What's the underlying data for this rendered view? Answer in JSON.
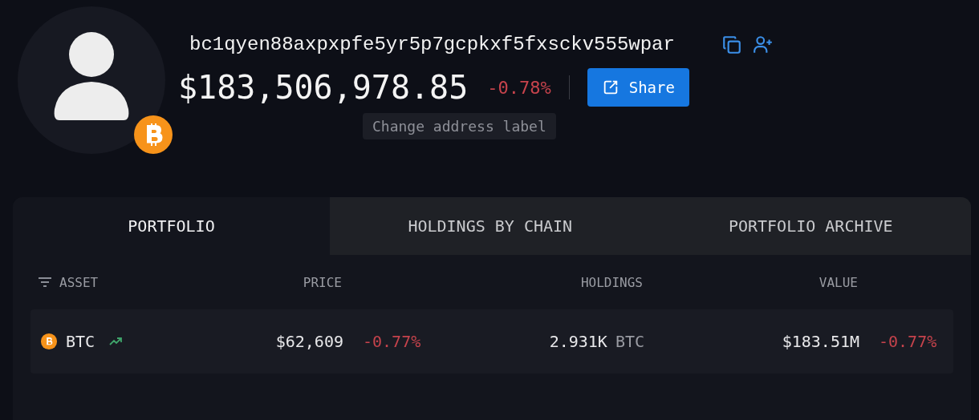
{
  "profile": {
    "address": "bc1qyen88axpxpfe5yr5p7gcpkxf5fxsckv555wpar",
    "balance": "$183,506,978.85",
    "change": "-0.78%",
    "tooltip": "Change address label",
    "share_button": "Share"
  },
  "tabs": [
    {
      "label": "PORTFOLIO",
      "selected": true
    },
    {
      "label": "HOLDINGS BY CHAIN",
      "selected": false
    },
    {
      "label": "PORTFOLIO ARCHIVE",
      "selected": false
    }
  ],
  "table": {
    "columns": [
      "ASSET",
      "PRICE",
      "HOLDINGS",
      "VALUE"
    ],
    "rows": [
      {
        "asset": "BTC",
        "price": "$62,609",
        "price_change": "-0.77%",
        "holdings": "2.931K",
        "holdings_unit": "BTC",
        "value": "$183.51M",
        "value_change": "-0.77%"
      }
    ]
  }
}
